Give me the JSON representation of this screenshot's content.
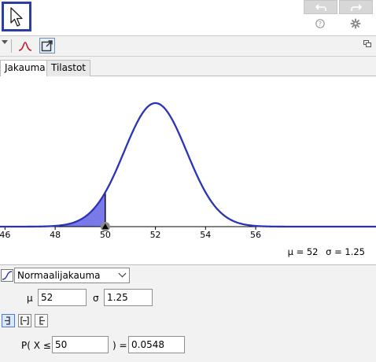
{
  "toolbar": {
    "move_tool_icon": "arrow-pointer-icon",
    "undo_icon": "undo-icon",
    "redo_icon": "redo-icon",
    "help_icon": "help-icon",
    "settings_icon": "gear-icon"
  },
  "panel": {
    "curve_button_icon": "normal-curve-icon",
    "export_button_icon": "export-icon",
    "dock_icon": "dock-icon"
  },
  "tabs": [
    {
      "label": "Jakauma",
      "active": true
    },
    {
      "label": "Tilastot",
      "active": false
    }
  ],
  "chart_data": {
    "type": "line",
    "distribution": "normal",
    "mean": 52,
    "sd": 1.25,
    "xlim": [
      45.8,
      60.8
    ],
    "x_ticks": [
      "46",
      "48",
      "50",
      "52",
      "54",
      "56"
    ],
    "shaded_region": {
      "to": 50,
      "color": "#6a6ae8"
    },
    "curve_color": "#2a34b8",
    "marker_x": 50
  },
  "readout": {
    "mu": "μ = 52",
    "sigma": "σ = 1.25"
  },
  "controls": {
    "distribution_label": "Normaalijakauma",
    "mu_label": "μ",
    "mu_value": "52",
    "sigma_label": "σ",
    "sigma_value": "1.25",
    "interval_modes": [
      "left-sided",
      "two-sided",
      "right-sided"
    ],
    "prob_prefix": "P( X ≤",
    "prob_bound": "50",
    "prob_mid": ") =",
    "prob_result": "0.0548"
  }
}
